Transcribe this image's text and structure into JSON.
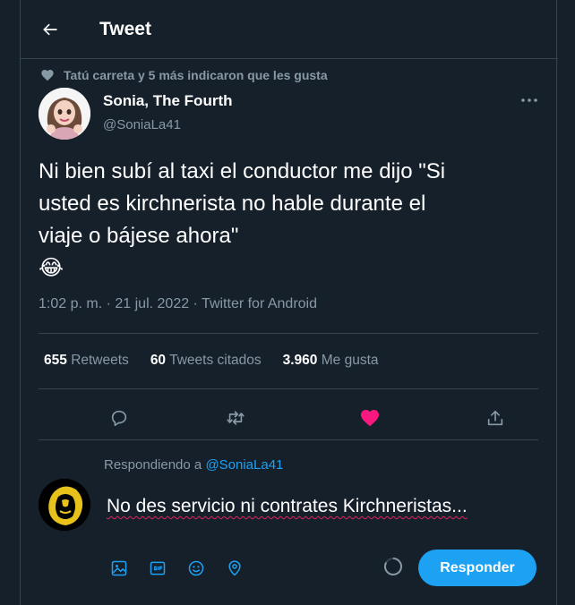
{
  "header": {
    "title": "Tweet",
    "back_icon": "arrow-left-icon"
  },
  "social_context": {
    "icon": "heart-icon",
    "text": "Tatú carreta y 5 más indicaron que les gusta"
  },
  "author": {
    "name": "Sonia, The Fourth",
    "handle": "@SoniaLa41"
  },
  "tweet": {
    "lines": [
      "Ni bien subí al taxi el conductor me dijo \"Si",
      "usted es kirchnerista no hable durante el",
      "viaje o bájese ahora\""
    ],
    "emoji": "😂"
  },
  "meta": {
    "time": "1:02 p. m.",
    "sep1": " · ",
    "date": "21 jul. 2022",
    "sep2": " · ",
    "source": "Twitter for Android"
  },
  "stats": [
    {
      "value": "655",
      "label": "Retweets"
    },
    {
      "value": "60",
      "label": "Tweets citados"
    },
    {
      "value": "3.960",
      "label": "Me gusta"
    }
  ],
  "actions": {
    "reply_icon": "reply-icon",
    "retweet_icon": "retweet-icon",
    "like_icon": "heart-filled-icon",
    "share_icon": "share-icon"
  },
  "reply": {
    "replying_prefix": "Respondiendo a ",
    "replying_to": "@SoniaLa41",
    "draft": "No des servicio ni contrates Kirchneristas...",
    "button_label": "Responder",
    "tools": [
      "image-icon",
      "gif-icon",
      "emoji-icon",
      "location-icon"
    ]
  },
  "colors": {
    "background": "#15202b",
    "accent": "#1da1f2",
    "like": "#f91880",
    "muted": "#8899a6",
    "border": "#38444d"
  }
}
